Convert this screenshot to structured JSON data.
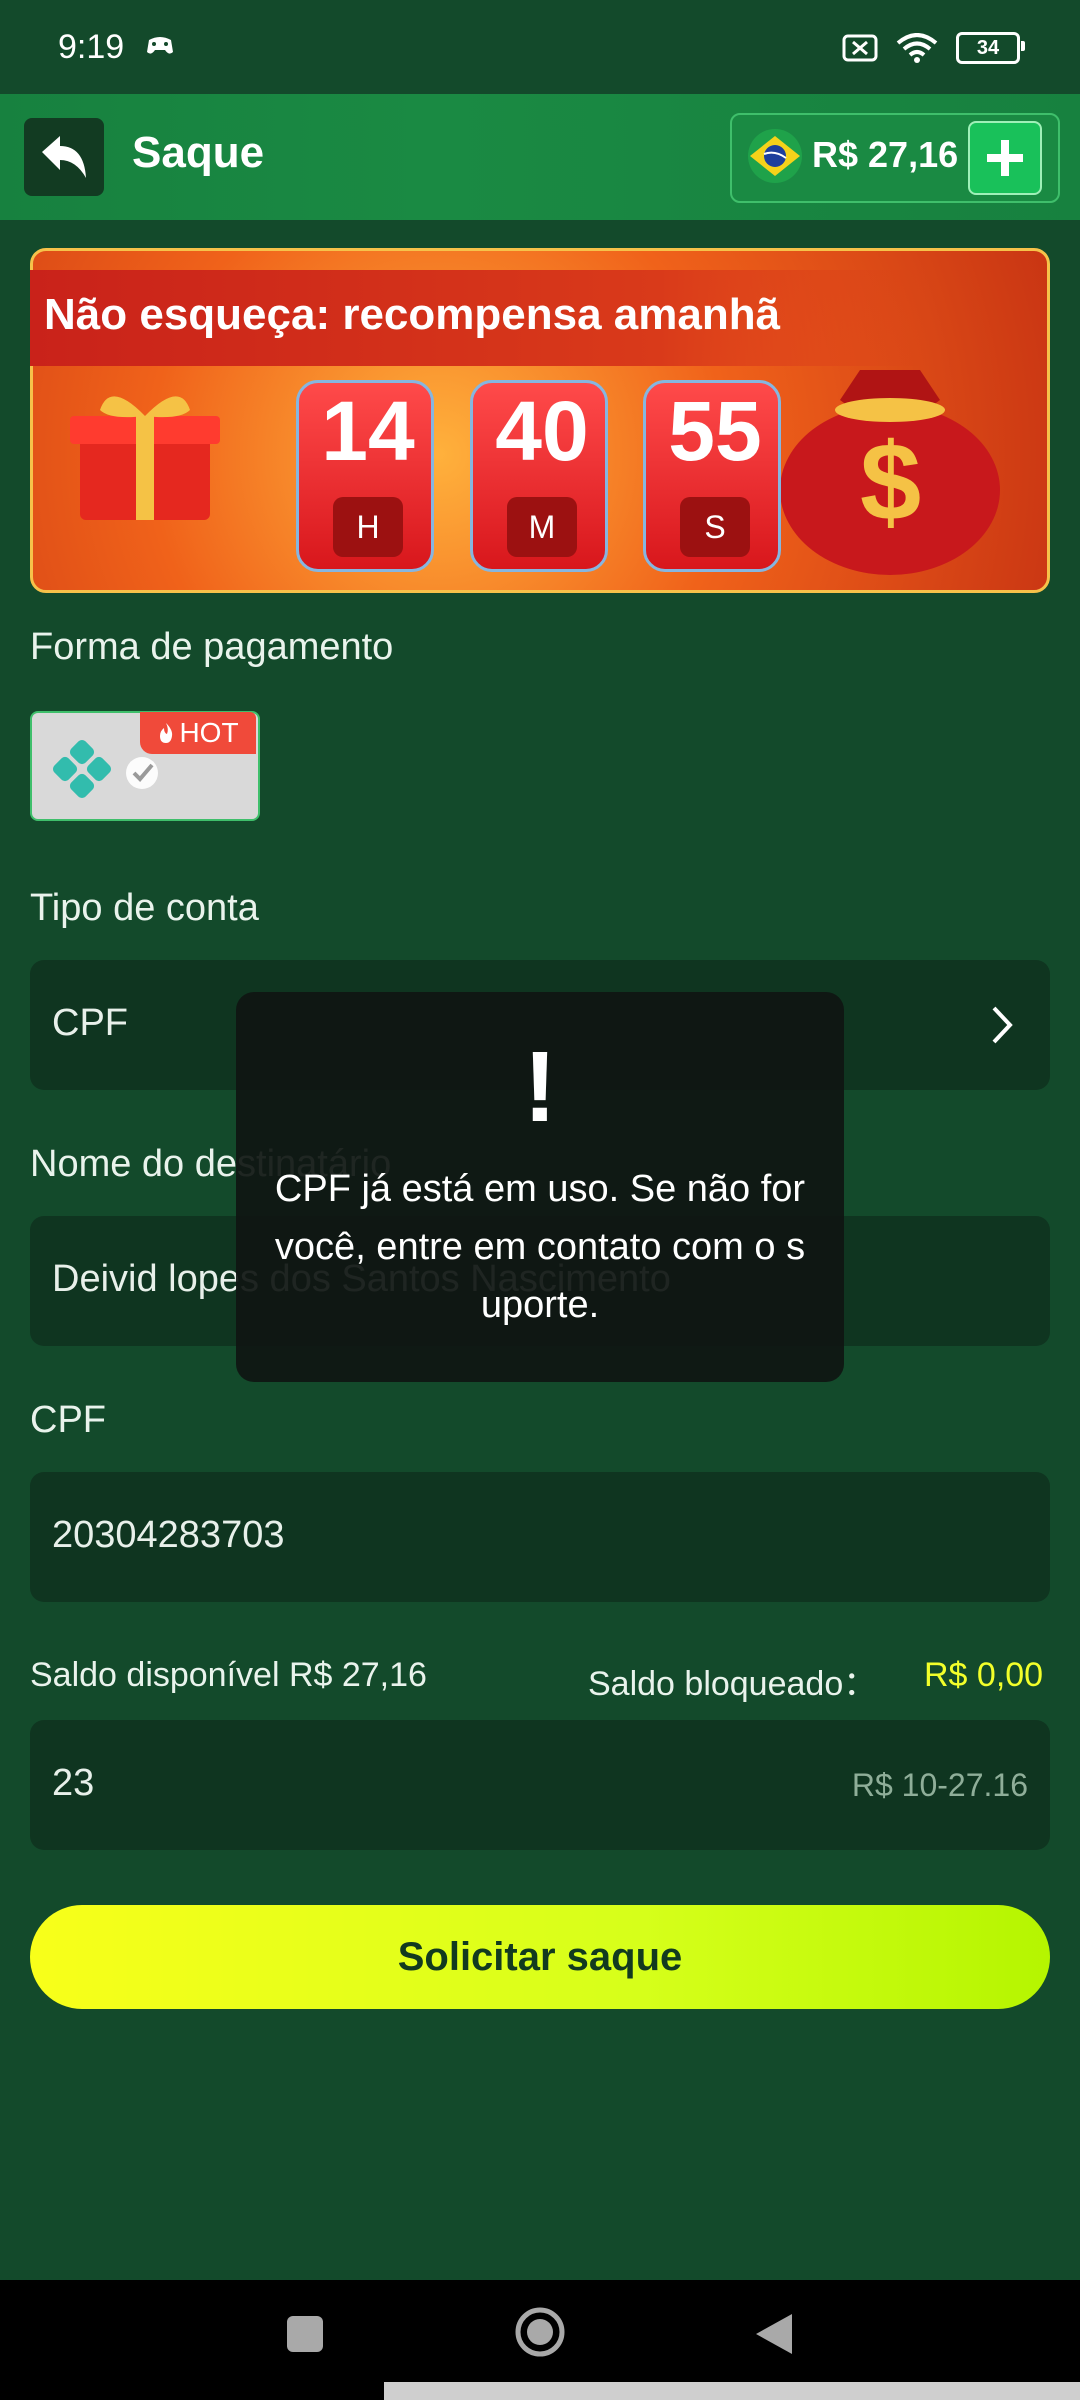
{
  "status_bar": {
    "time": "9:19",
    "battery": "34"
  },
  "header": {
    "title": "Saque",
    "balance": "R$ 27,16"
  },
  "banner": {
    "title": "Não esqueça: recompensa amanhã",
    "timer": [
      {
        "value": "14",
        "unit": "H"
      },
      {
        "value": "40",
        "unit": "M"
      },
      {
        "value": "55",
        "unit": "S"
      }
    ]
  },
  "payment": {
    "label": "Forma de pagamento",
    "method": "pix",
    "badge": "HOT"
  },
  "account_type": {
    "label": "Tipo de conta",
    "value": "CPF"
  },
  "recipient": {
    "label": "Nome do destinatário",
    "value": "Deivid lopes dos Santos Nascimento"
  },
  "cpf": {
    "label": "CPF",
    "value": "20304283703"
  },
  "balance_info": {
    "available": "Saldo disponível R$ 27,16",
    "blocked_label": "Saldo bloqueado：",
    "blocked_value": "R$ 0,00"
  },
  "amount": {
    "value": "23",
    "range": "R$ 10-27.16"
  },
  "submit_label": "Solicitar saque",
  "toast": {
    "icon": "!",
    "message": "CPF já está em uso. Se não for você, entre em contato com o suporte."
  },
  "colors": {
    "background": "#134a2b",
    "accent": "#d6ff1a",
    "blocked_value": "#f2ff2a"
  }
}
